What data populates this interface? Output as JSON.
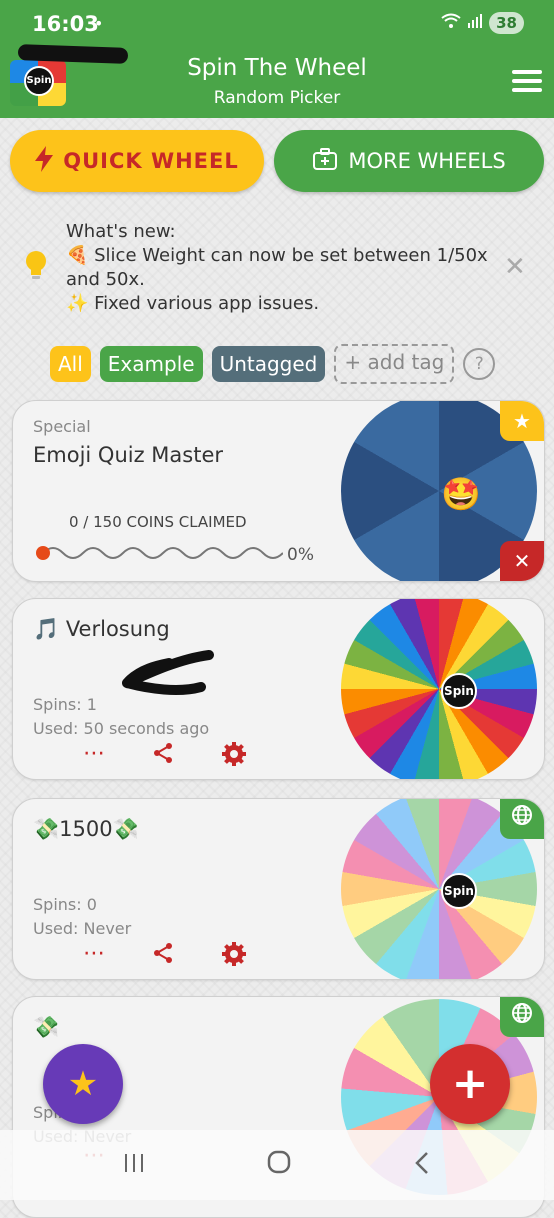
{
  "status": {
    "time": "16:03",
    "battery": "38"
  },
  "header": {
    "title": "Spin The Wheel",
    "subtitle": "Random Picker",
    "logo_text": "Spin"
  },
  "buttons": {
    "quick_wheel": "QUICK WHEEL",
    "more_wheels": "MORE WHEELS"
  },
  "whats_new": {
    "heading": "What's new:",
    "line1": "🍕 Slice Weight can now be set between 1/50x and 50x.",
    "line2": "✨ Fixed various app issues."
  },
  "tags": {
    "all": "All",
    "example": "Example",
    "untagged": "Untagged",
    "add": "+ add tag",
    "help": "?"
  },
  "cards": [
    {
      "category": "Special",
      "name": "Emoji Quiz Master",
      "coins": "0 / 150 COINS CLAIMED",
      "progress_pct": "0%",
      "progress": 0,
      "center_emoji": "🤩"
    },
    {
      "name": "🎵 Verlosung",
      "spins": "Spins: 1",
      "used": "Used: 50 seconds ago",
      "center_label": "Spin"
    },
    {
      "name": "💸1500💸",
      "spins": "Spins: 0",
      "used": "Used: Never",
      "center_label": "Spin"
    },
    {
      "name": "💸",
      "spins": "Spins: 0",
      "used": "Used: Never"
    }
  ],
  "icons": {
    "more": "⋯",
    "share": "share-icon",
    "settings": "gear-icon",
    "star": "★",
    "close": "✕",
    "globe": "globe-icon",
    "add": "+",
    "menu": "menu-icon"
  },
  "colors": {
    "brand_green": "#4aa548",
    "accent_yellow": "#fdc31a",
    "action_red": "#c62828",
    "fab_purple": "#673ab7"
  }
}
